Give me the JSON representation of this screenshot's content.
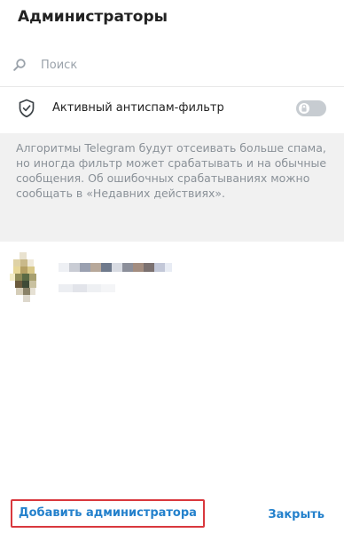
{
  "dialog": {
    "title": "Администраторы"
  },
  "search": {
    "placeholder": "Поиск",
    "icon": "search-icon"
  },
  "antispam": {
    "label": "Активный антиспам-фильтр",
    "icon": "shield-check-icon",
    "enabled": false,
    "locked": true
  },
  "info": {
    "text": "Алгоритмы Telegram будут отсеивать больше спама, но иногда фильтр может срабатывать и на обычные сообщения. Об ошибочных срабатываниях можно сообщать в «Недавних действиях»."
  },
  "footer": {
    "add_label": "Добавить администратора",
    "close_label": "Закрыть"
  },
  "colors": {
    "accent": "#2481cc",
    "highlight_border": "#d9383d",
    "info_bg": "#f1f1f1",
    "muted_text": "#8a9198"
  }
}
